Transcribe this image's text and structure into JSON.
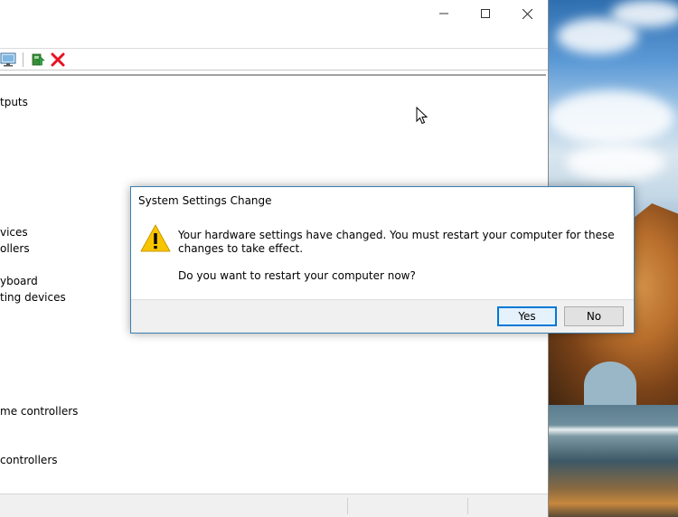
{
  "main_window": {
    "tree_items": [
      "tputs",
      "vices",
      "ollers",
      "yboard",
      "ting devices",
      "me controllers",
      "controllers"
    ],
    "icons": {
      "minimize": "minimize-icon",
      "maximize": "maximize-icon",
      "close": "close-icon",
      "toolbar": [
        "monitor-scan-icon",
        "update-driver-icon",
        "uninstall-x-icon"
      ]
    }
  },
  "dialog": {
    "title": "System Settings Change",
    "message": "Your hardware settings have changed. You must restart your computer for these changes to take effect.",
    "question": "Do you want to restart your computer now?",
    "yes_label": "Yes",
    "no_label": "No",
    "icon": "warning-icon"
  },
  "colors": {
    "dialog_border": "#3c7fb1",
    "default_button_border": "#0078d7",
    "warning_yellow": "#f7c400",
    "uninstall_red": "#e81123"
  }
}
